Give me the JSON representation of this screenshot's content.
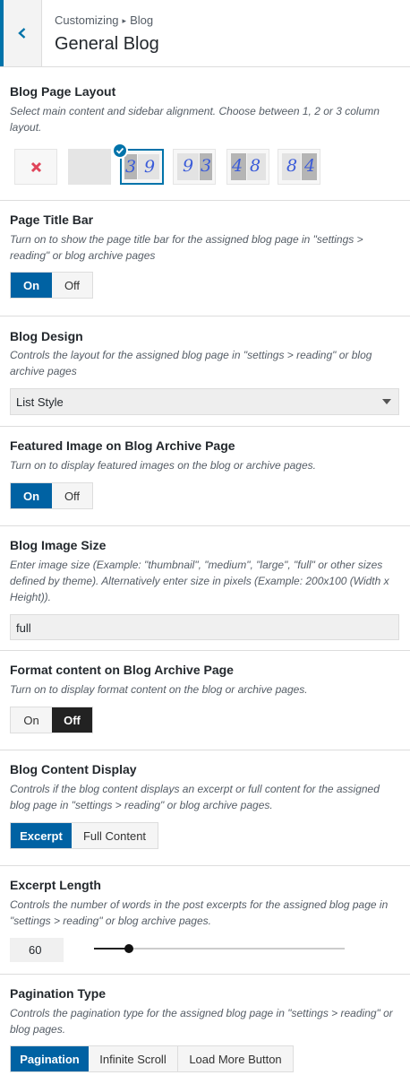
{
  "header": {
    "crumb_parent": "Customizing",
    "crumb_child": "Blog",
    "title": "General Blog"
  },
  "blog_page_layout": {
    "title": "Blog Page Layout",
    "description": "Select main content and sidebar alignment. Choose between 1, 2 or 3 column layout.",
    "selected_index": 2,
    "options": [
      {
        "name": "none",
        "digits": []
      },
      {
        "name": "full-width",
        "digits": []
      },
      {
        "name": "left-sidebar",
        "digits": [
          "3",
          "9"
        ]
      },
      {
        "name": "right-sidebar",
        "digits": [
          "9",
          "3"
        ]
      },
      {
        "name": "left-sidebar-4-8",
        "digits": [
          "4",
          "8"
        ]
      },
      {
        "name": "right-sidebar-8-4",
        "digits": [
          "8",
          "4"
        ]
      }
    ]
  },
  "page_title_bar": {
    "title": "Page Title Bar",
    "description": "Turn on to show the page title bar for the assigned blog page in \"settings > reading\" or blog archive pages",
    "on_label": "On",
    "off_label": "Off",
    "value": "On"
  },
  "blog_design": {
    "title": "Blog Design",
    "description": "Controls the layout for the assigned blog page in \"settings > reading\" or blog archive pages",
    "selected": "List Style"
  },
  "featured_image": {
    "title": "Featured Image on Blog Archive Page",
    "description": "Turn on to display featured images on the blog or archive pages.",
    "on_label": "On",
    "off_label": "Off",
    "value": "On"
  },
  "blog_image_size": {
    "title": "Blog Image Size",
    "description": "Enter image size (Example: \"thumbnail\", \"medium\", \"large\", \"full\" or other sizes defined by theme). Alternatively enter size in pixels (Example: 200x100 (Width x Height)).",
    "value": "full"
  },
  "format_content": {
    "title": "Format content on Blog Archive Page",
    "description": "Turn on to display format content on the blog or archive pages.",
    "on_label": "On",
    "off_label": "Off",
    "value": "Off"
  },
  "blog_content_display": {
    "title": "Blog Content Display",
    "description": "Controls if the blog content displays an excerpt or full content for the assigned blog page in \"settings > reading\" or blog archive pages.",
    "options": [
      "Excerpt",
      "Full Content"
    ],
    "value": "Excerpt"
  },
  "excerpt_length": {
    "title": "Excerpt Length",
    "description": "Controls the number of words in the post excerpts for the assigned blog page in \"settings > reading\" or blog archive pages.",
    "value": "60",
    "slider_fraction": 0.14
  },
  "pagination_type": {
    "title": "Pagination Type",
    "description": "Controls the pagination type for the assigned blog page in \"settings > reading\" or blog pages.",
    "options": [
      "Pagination",
      "Infinite Scroll",
      "Load More Button"
    ],
    "value": "Pagination"
  },
  "colors": {
    "accent": "#0073aa",
    "active_button": "#0062a3",
    "dark_button": "#222222"
  }
}
